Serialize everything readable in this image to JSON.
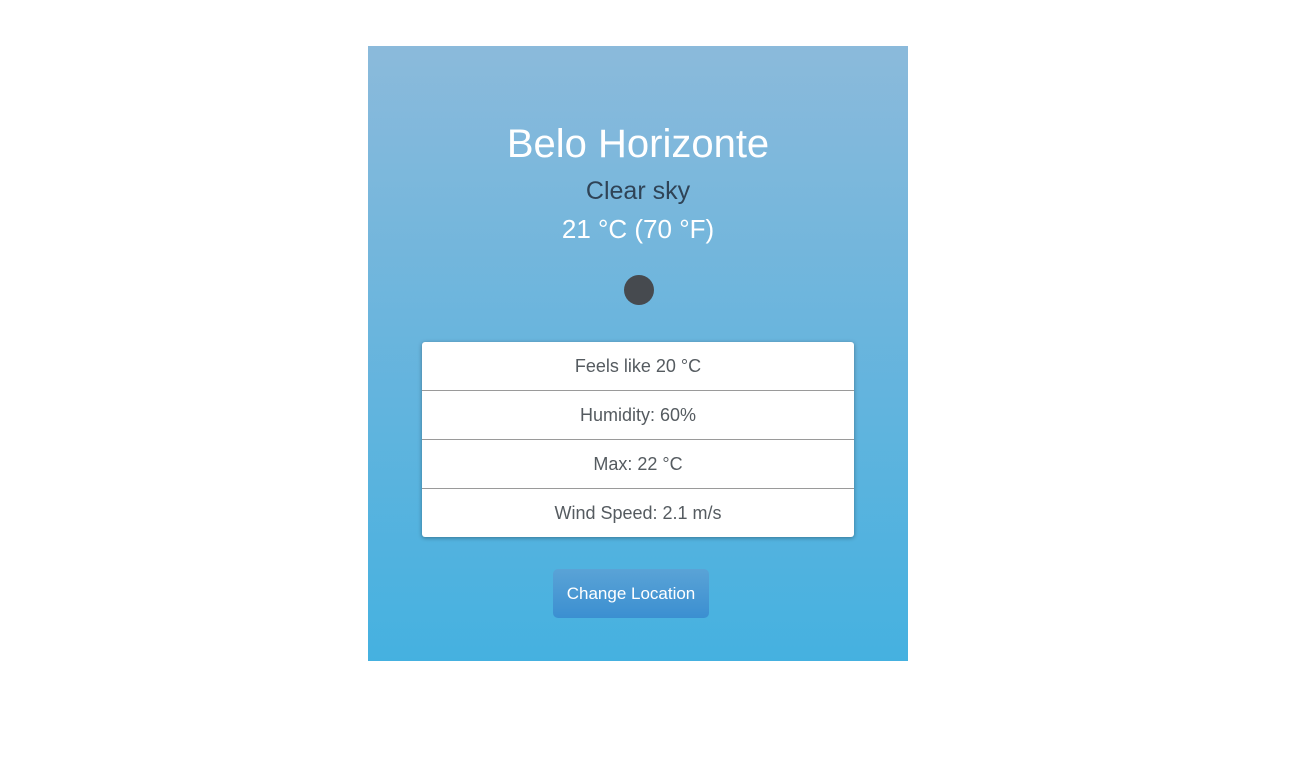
{
  "weather": {
    "city": "Belo Horizonte",
    "description": "Clear sky",
    "temperature": "21 °C (70 °F)",
    "icon": "weather-icon-placeholder"
  },
  "details": [
    {
      "label": "Feels like 20 °C"
    },
    {
      "label": "Humidity: 60%"
    },
    {
      "label": "Max: 22 °C"
    },
    {
      "label": "Wind Speed: 2.1 m/s"
    }
  ],
  "actions": {
    "change_location_label": "Change Location"
  },
  "colors": {
    "card_top": "#8bbadb",
    "card_bottom": "#45b1e0",
    "button": "#4a9ad4",
    "icon": "#464a4f"
  }
}
